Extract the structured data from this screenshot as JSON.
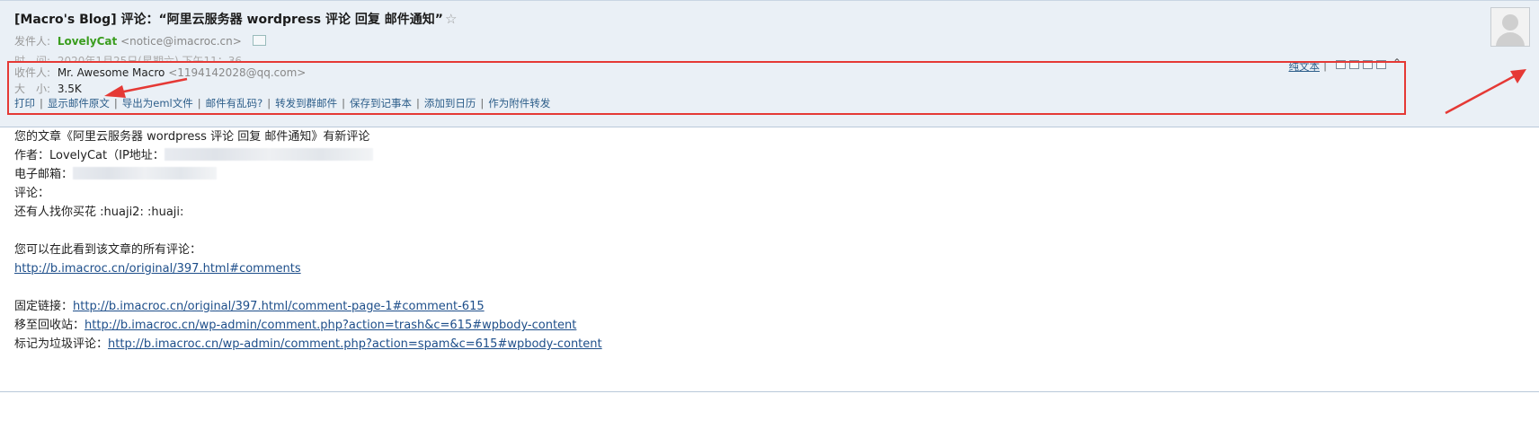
{
  "email": {
    "subject": "[Macro's Blog] 评论：“阿里云服务器 wordpress 评论 回复 邮件通知”",
    "star_glyph": "☆",
    "sender_label": "发件人:",
    "sender_name": "LovelyCat",
    "sender_email": "<notice@imacroc.cn>",
    "time_label": "时　间:",
    "time_value": "2020年1月25日(星期六) 下午11：36",
    "recipient_label": "收件人:",
    "recipient_name": "Mr. Awesome Macro",
    "recipient_email": "<1194142028@qq.com>",
    "size_label": "大　小:",
    "size_value": "3.5K",
    "plain_text_label": "纯文本",
    "plain_text_sep": "|",
    "collapse_glyph": "⌃",
    "actions": {
      "print": "打印",
      "show_source": "显示邮件原文",
      "export_eml": "导出为eml文件",
      "garbled": "邮件有乱码?",
      "forward_group": "转发到群邮件",
      "save_note": "保存到记事本",
      "add_calendar": "添加到日历",
      "forward_attachment": "作为附件转发",
      "sep": "|"
    }
  },
  "body": {
    "line1": "您的文章《阿里云服务器 wordpress 评论 回复 邮件通知》有新评论",
    "author_label": "作者：LovelyCat（IP地址：",
    "email_label": "电子邮箱：",
    "comment_label": "评论：",
    "comment_text": "还有人找你买花 :huaji2:  :huaji:",
    "view_all_label": "您可以在此看到该文章的所有评论：",
    "view_all_link": "http://b.imacroc.cn/original/397.html#comments",
    "permalink_label": "固定链接：",
    "permalink_link": "http://b.imacroc.cn/original/397.html/comment-page-1#comment-615",
    "trash_label": "移至回收站：",
    "trash_link": "http://b.imacroc.cn/wp-admin/comment.php?action=trash&c=615#wpbody-content",
    "spam_label": "标记为垃圾评论：",
    "spam_link": "http://b.imacroc.cn/wp-admin/comment.php?action=spam&c=615#wpbody-content"
  },
  "colors": {
    "header_bg": "#eaf0f6",
    "highlight": "#e53935",
    "sender_green": "#3a9d1e",
    "link_blue": "#1d4e8a"
  }
}
